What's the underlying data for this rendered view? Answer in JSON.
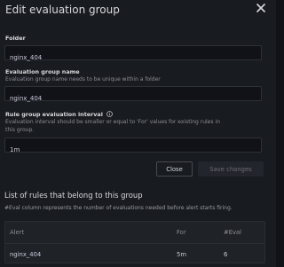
{
  "modal": {
    "title": "Edit evaluation group",
    "close_icon": "close-icon"
  },
  "folder": {
    "label": "Folder",
    "value": "nginx_404"
  },
  "group_name": {
    "label": "Evaluation group name",
    "description": "Evaluation group name needs to be unique within a folder",
    "value": "nginx_404"
  },
  "interval": {
    "label": "Rule group evaluation interval",
    "info_icon": "info-circle-icon",
    "description_line1": "Evaluation interval should be smaller or equal to 'For' values for existing rules in",
    "description_line2": "this group.",
    "value": "1m"
  },
  "actions": {
    "close_label": "Close",
    "save_label": "Save changes"
  },
  "rules": {
    "title": "List of rules that belong to this group",
    "description": "#Eval column represents the number of evaluations needed before alert starts firing.",
    "columns": [
      "Alert",
      "For",
      "#Eval"
    ],
    "rows": [
      {
        "alert": "nginx_404",
        "for": "5m",
        "eval": "6"
      }
    ]
  },
  "colors": {
    "background": "#181b1f",
    "input_bg": "#111217",
    "text": "#ccccdc",
    "muted": "#8e8e98"
  }
}
